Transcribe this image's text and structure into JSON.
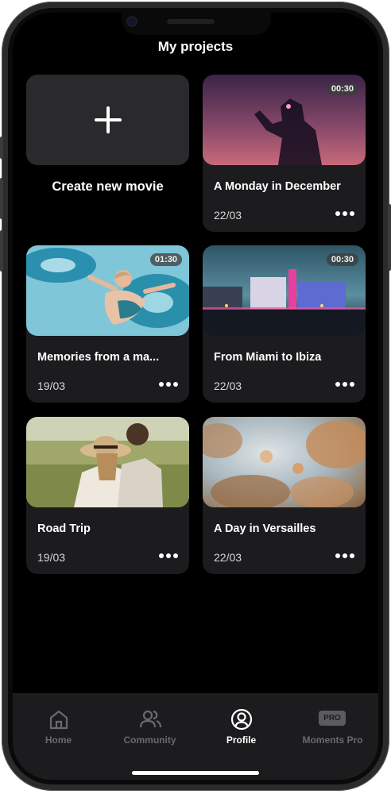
{
  "header": {
    "title": "My projects"
  },
  "create": {
    "label": "Create new movie"
  },
  "projects": [
    {
      "title": "A Monday in December",
      "date": "22/03",
      "duration": "00:30"
    },
    {
      "title": "Memories from a ma...",
      "date": "19/03",
      "duration": "01:30"
    },
    {
      "title": "From Miami to Ibiza",
      "date": "22/03",
      "duration": "00:30"
    },
    {
      "title": "Road Trip",
      "date": "19/03",
      "duration": ""
    },
    {
      "title": "A Day in Versailles",
      "date": "22/03",
      "duration": ""
    }
  ],
  "tabs": [
    {
      "label": "Home",
      "icon": "home-icon",
      "active": false
    },
    {
      "label": "Community",
      "icon": "people-icon",
      "active": false
    },
    {
      "label": "Profile",
      "icon": "profile-icon",
      "active": true
    },
    {
      "label": "Moments Pro",
      "icon": "pro-badge",
      "badge": "PRO",
      "active": false
    }
  ],
  "colors": {
    "background": "#000000",
    "card": "#1c1c1e",
    "tabbar": "#1c1c1e",
    "active_tab": "#ffffff",
    "inactive_tab": "#6a6a6e"
  }
}
